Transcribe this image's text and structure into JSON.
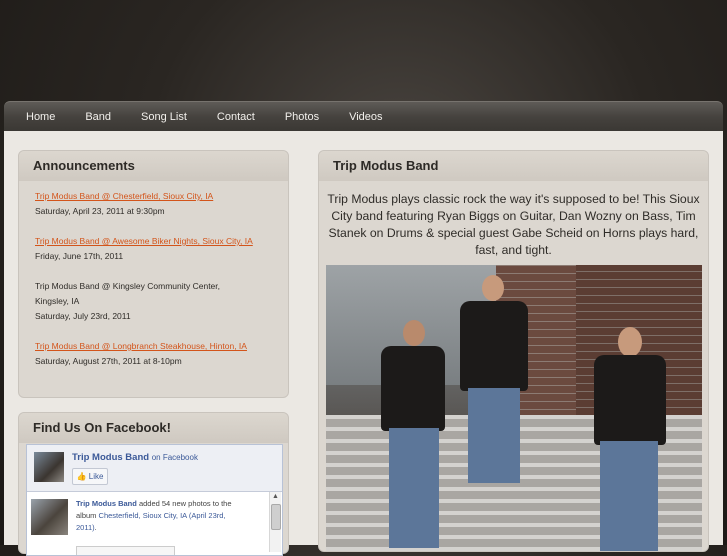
{
  "nav": [
    "Home",
    "Band",
    "Song List",
    "Contact",
    "Photos",
    "Videos"
  ],
  "announcements": {
    "title": "Announcements",
    "events": [
      {
        "link": "Trip Modus Band @ Chesterfield, Sioux City, IA",
        "date": "Saturday, April 23, 2011 at 9:30pm"
      },
      {
        "link": "Trip Modus Band @ Awesome Biker Nights, Sioux City, IA",
        "date": "Friday, June 17th, 2011"
      },
      {
        "line1": "Trip Modus Band @ Kingsley Community Center,",
        "line2": "Kingsley, IA",
        "date": "Saturday, July 23rd, 2011"
      },
      {
        "link": "Trip Modus Band @ Longbranch Steakhouse, Hinton, IA",
        "date": "Saturday, August 27th, 2011 at 8-10pm"
      }
    ]
  },
  "facebook": {
    "title": "Find Us On Facebook!",
    "page_name": "Trip Modus Band",
    "on_facebook": "on Facebook",
    "like": "Like",
    "post_author": "Trip Modus Band",
    "post_text_1": "added 54 new photos to the album",
    "post_album": "Chesterfield, Sioux City, IA (April 23rd, 2011)",
    "post_end": "."
  },
  "band": {
    "title": "Trip Modus Band",
    "description": "Trip Modus plays classic rock the way it's supposed to be! This Sioux City band featuring Ryan Biggs on Guitar, Dan Wozny on Bass, Tim Stanek on Drums & special guest Gabe Scheid on Horns plays hard, fast, and tight."
  }
}
